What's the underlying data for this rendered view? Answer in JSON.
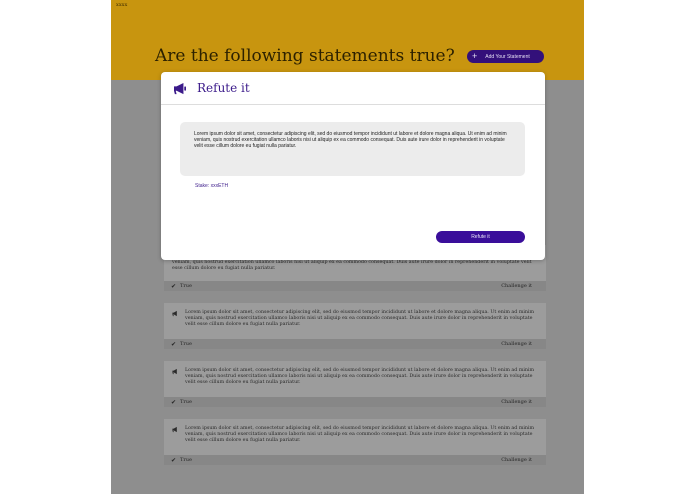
{
  "header": {
    "brand": "xxxx",
    "title": "Are the following statements true?",
    "add_button_label": "Add Your Statement"
  },
  "modal": {
    "title": "Refute it",
    "statement": "Lorem ipsum dolor sit amet, consectetur adipiscing elit, sed do eiusmod tempor incididunt ut labore et dolore magna aliqua. Ut enim ad minim veniam, quis nostrud exercitation ullamco laboris nisi ut aliquip ex ea commodo consequat. Duis aute irure dolor in reprehenderit in voluptate velit esse cillum dolore eu fugiat nulla pariatur.",
    "stake": "Stake: xxxETH",
    "refute_button_label": "Refute it"
  },
  "cards": [
    {
      "text": "veniam, quis nostrud exercitation ullamco laboris nisi ut aliquip ex ea commodo consequat. Duis aute irure dolor in reprehenderit in voluptate velit esse cillum dolore eu fugiat nulla pariatur.",
      "status": "True",
      "action": "Challenge it"
    },
    {
      "text": "Lorem ipsum dolor sit amet, consectetur adipiscing elit, sed do eiusmod tempor incididunt ut labore et dolore magna aliqua. Ut enim ad minim veniam, quis nostrud exercitation ullamco laboris nisi ut aliquip ex ea commodo consequat. Duis aute irure dolor in reprehenderit in voluptate velit esse cillum dolore eu fugiat nulla pariatur.",
      "status": "True",
      "action": "Challenge it"
    },
    {
      "text": "Lorem ipsum dolor sit amet, consectetur adipiscing elit, sed do eiusmod tempor incididunt ut labore et dolore magna aliqua. Ut enim ad minim veniam, quis nostrud exercitation ullamco laboris nisi ut aliquip ex ea commodo consequat. Duis aute irure dolor in reprehenderit in voluptate velit esse cillum dolore eu fugiat nulla pariatur.",
      "status": "True",
      "action": "Challenge it"
    },
    {
      "text": "Lorem ipsum dolor sit amet, consectetur adipiscing elit, sed do eiusmod tempor incididunt ut labore et dolore magna aliqua. Ut enim ad minim veniam, quis nostrud exercitation ullamco laboris nisi ut aliquip ex ea commodo consequat. Duis aute irure dolor in reprehenderit in voluptate velit esse cillum dolore eu fugiat nulla pariatur.",
      "status": "True",
      "action": "Challenge it"
    }
  ],
  "colors": {
    "header_bg": "#c8950f",
    "accent": "#3b1a8a",
    "overlay_bg": "#8e8e8e"
  },
  "icons": {
    "modal_icon": "megaphone-icon",
    "card_icon": "megaphone-icon",
    "status_icon": "check-icon",
    "add_icon": "plus-icon"
  }
}
